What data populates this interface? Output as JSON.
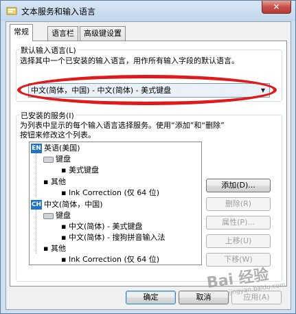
{
  "window": {
    "title": "文本服务和输入语言",
    "close_glyph": "✕"
  },
  "tabs": [
    {
      "label": "常规",
      "active": true
    },
    {
      "label": "语言栏",
      "active": false
    },
    {
      "label": "高级键设置",
      "active": false
    }
  ],
  "default_language": {
    "group_label": "默认输入语言(L)",
    "description": "选择其中一个已安装的输入语言，用作所有输入字段的默认语言。",
    "selected": "中文(简体，中国) - 中文(简体) - 美式键盘"
  },
  "installed_services": {
    "group_label": "已安装的服务(I)",
    "description_line1": "为列表中显示的每个输入语言选择服务。使用“添加”和“删除”",
    "description_line2": "按钮来修改这个列表。",
    "tree": [
      {
        "text": "英语(美国)",
        "icon": "EN"
      },
      {
        "text": "键盘"
      },
      {
        "text": "美式键盘"
      },
      {
        "text": "其他"
      },
      {
        "text": "Ink Correction (仅 64 位)"
      },
      {
        "text": "中文(简体，中国)",
        "icon": "CH"
      },
      {
        "text": "键盘"
      },
      {
        "text": "中文(简体) - 美式键盘"
      },
      {
        "text": "中文(简体) - 搜狗拼音输入法"
      },
      {
        "text": "其他"
      },
      {
        "text": "Ink Correction (仅 64 位)"
      }
    ]
  },
  "buttons": {
    "add": "添加(D)...",
    "remove": "删除(R)",
    "properties": "属性(P)...",
    "move_up": "上移(U)",
    "move_down": "下移(W)"
  },
  "footer": {
    "ok": "确定",
    "cancel": "取消",
    "apply": "应用(A)"
  },
  "watermark": {
    "text": "Bai 经验",
    "sub": "jingyan.baidu.com"
  },
  "colors": {
    "highlight_ellipse": "#e01a1a",
    "lang_icon": "#1e73c8"
  }
}
